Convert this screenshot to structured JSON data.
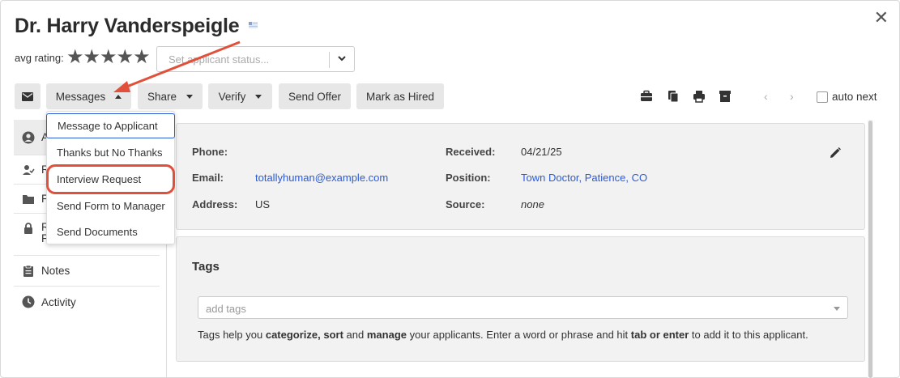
{
  "applicant": {
    "name": "Dr. Harry Vanderspeigle"
  },
  "rating": {
    "label": "avg rating:",
    "stars": "★★★★★",
    "value": 5
  },
  "status": {
    "placeholder": "Set applicant status..."
  },
  "toolbar": {
    "messages": "Messages",
    "share": "Share",
    "verify": "Verify",
    "send_offer": "Send Offer",
    "mark_hired": "Mark as Hired",
    "auto_next": "auto next"
  },
  "messages_menu": [
    "Message to Applicant",
    "Thanks but No Thanks",
    "Interview Request",
    "Send Form to Manager",
    "Send Documents"
  ],
  "sidebar": {
    "items": [
      {
        "label": "A"
      },
      {
        "label": "R"
      },
      {
        "label": "F"
      },
      {
        "label": "R",
        "sub": "Files"
      },
      {
        "label": "Notes"
      },
      {
        "label": "Activity"
      }
    ]
  },
  "details": {
    "phone_label": "Phone:",
    "phone": "",
    "email_label": "Email:",
    "email": "totallyhuman@example.com",
    "address_label": "Address:",
    "address": "US",
    "received_label": "Received:",
    "received": "04/21/25",
    "position_label": "Position:",
    "position": "Town Doctor, Patience, CO",
    "source_label": "Source:",
    "source": "none"
  },
  "tags": {
    "heading": "Tags",
    "placeholder": "add tags",
    "help": {
      "p1": "Tags help you ",
      "b1": "categorize, sort",
      "p2": " and ",
      "b2": "manage",
      "p3": " your applicants. Enter a word or phrase and hit ",
      "b3": "tab or enter",
      "p4": " to add it to this applicant."
    }
  },
  "colors": {
    "link": "#2a5bd7",
    "annotation": "#e0503a",
    "button_bg": "#e7e7e7"
  }
}
